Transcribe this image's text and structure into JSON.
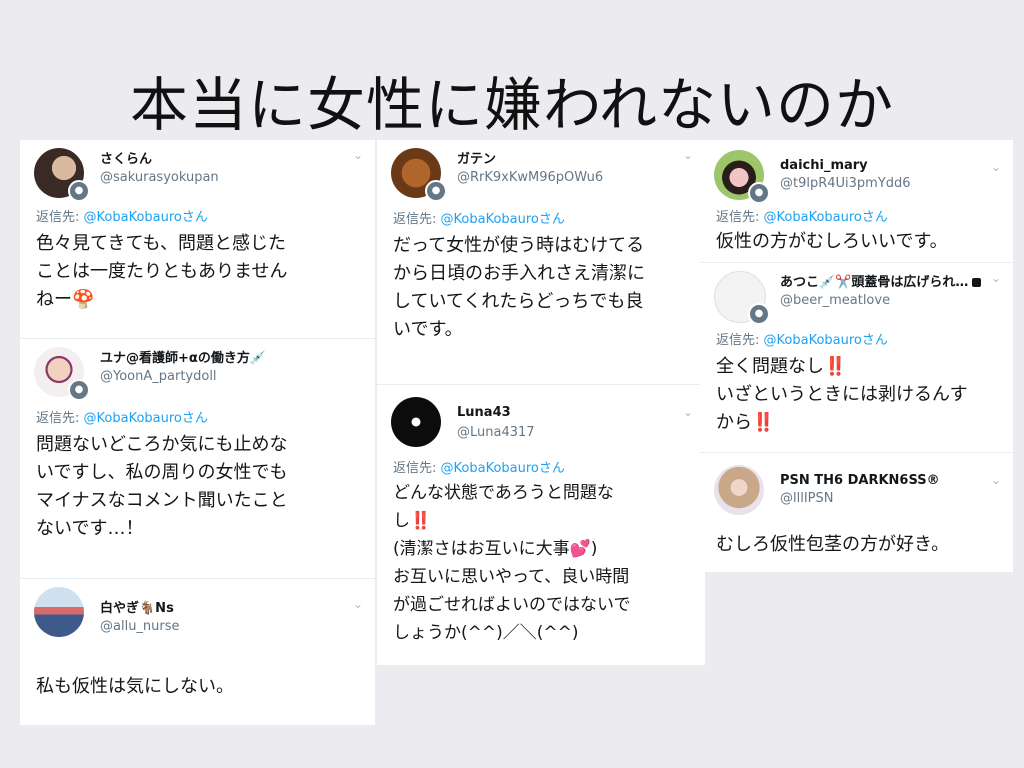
{
  "slide": {
    "title": "本当に女性に嫌われないのか"
  },
  "columns": [
    {
      "tweets": [
        {
          "name": "さくらん",
          "handle": "@sakurasyokupan",
          "reply_prefix": "返信先: ",
          "reply_to": "@KobaKobauroさん",
          "body_lines": [
            "色々見てきても、問題と感じた",
            "ことは一度たりともありません",
            "ねー🍄"
          ]
        },
        {
          "name": "ユナ@看護師+αの働き方💉",
          "handle": "@YoonA_partydoll",
          "reply_prefix": "返信先: ",
          "reply_to": "@KobaKobauroさん",
          "body_lines": [
            "問題ないどころか気にも止めな",
            "いですし、私の周りの女性でも",
            "マイナスなコメント聞いたこと",
            "ないです…！"
          ]
        },
        {
          "name": "白やぎ🐐Ns",
          "handle": "@allu_nurse",
          "body_lines": [
            "私も仮性は気にしない。"
          ]
        }
      ]
    },
    {
      "tweets": [
        {
          "name": "ガテン",
          "handle": "@RrK9xKwM96pOWu6",
          "reply_prefix": "返信先: ",
          "reply_to": "@KobaKobauroさん",
          "body_lines": [
            "だって女性が使う時はむけてる",
            "から日頃のお手入れさえ清潔に",
            "していてくれたらどっちでも良",
            "いです。"
          ]
        },
        {
          "name": "Luna43",
          "handle": "@Luna4317",
          "reply_prefix": "返信先: ",
          "reply_to": "@KobaKobauroさん",
          "body_lines": [
            "どんな状態であろうと問題な",
            "し‼️",
            "(清潔さはお互いに大事💕)",
            "お互いに思いやって、良い時間",
            "が過ごせればよいのではないで",
            "しょうか(^^)／＼(^^)"
          ]
        }
      ]
    },
    {
      "tweets": [
        {
          "name": "daichi_mary",
          "handle": "@t9lpR4Ui3pmYdd6",
          "reply_prefix": "返信先: ",
          "reply_to": "@KobaKobauroさん",
          "body_lines": [
            "仮性の方がむしろいいです。"
          ]
        },
        {
          "name": "あつこ💉✂️頭蓋骨は広げられ…",
          "handle": "@beer_meatlove",
          "reply_prefix": "返信先: ",
          "reply_to": "@KobaKobauroさん",
          "body_lines": [
            "全く問題なし‼️",
            "いざというときには剥けるんす",
            "から‼️"
          ]
        },
        {
          "name": "PSN TH6 DARKN6SS®",
          "handle": "@lllIPSN",
          "body_lines": [
            "むしろ仮性包茎の方が好き。"
          ]
        }
      ]
    }
  ],
  "icons": {
    "chevron": "chevron-down-icon",
    "badge": "follow-badge-icon",
    "lock": "lock-icon"
  },
  "colors": {
    "link": "#1da1f2",
    "muted": "#657786",
    "background": "#ececf0"
  }
}
